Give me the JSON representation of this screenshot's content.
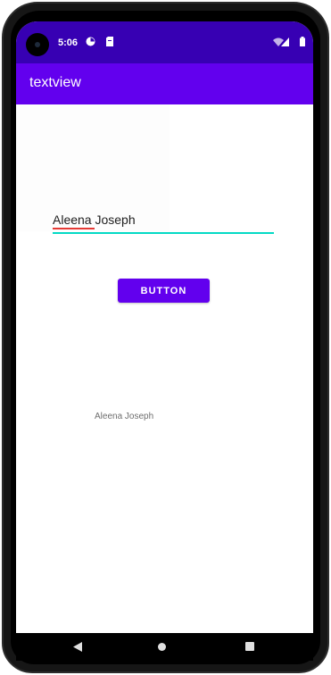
{
  "status_bar": {
    "time": "5:06",
    "background": "#3700b3",
    "icons": [
      "sync-icon",
      "sim-card-icon",
      "wifi-icon",
      "signal-icon",
      "battery-icon"
    ]
  },
  "app_bar": {
    "title": "textview",
    "background": "#6200ee"
  },
  "main": {
    "edit_text_value": "Aleena Joseph",
    "edit_text_underline_color": "#03dac5",
    "button_label": "BUTTON",
    "button_color": "#6200ee",
    "result_text": "Aleena Joseph"
  },
  "nav_bar": {
    "icons": [
      "back-icon",
      "home-icon",
      "recents-icon"
    ]
  }
}
